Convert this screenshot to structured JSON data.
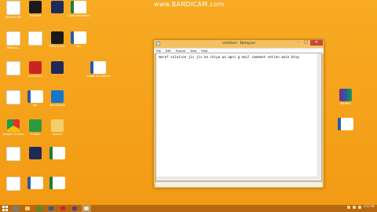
{
  "watermark": "www.BANDICAM.com",
  "desktop_icons": [
    {
      "name": "recycle-bin-icon",
      "label": "Recycle Bin",
      "glyph": "g-doc"
    },
    {
      "name": "file-icon-1",
      "label": "shortcut",
      "glyph": "g-dark"
    },
    {
      "name": "file-icon-2",
      "label": "",
      "glyph": "g-navy"
    },
    {
      "name": "excel-icon-1",
      "label": "Excel document",
      "glyph": "g-excel"
    },
    {
      "name": "app-icon-1",
      "label": "Bahasa...",
      "glyph": "g-doc"
    },
    {
      "name": "image-icon-1",
      "label": "",
      "glyph": "g-doc"
    },
    {
      "name": "app-icon-2",
      "label": "Office mod...",
      "glyph": "g-dark"
    },
    {
      "name": "word-icon-1",
      "label": "doc",
      "glyph": "g-word"
    },
    {
      "name": "file-icon-3",
      "label": "",
      "glyph": "g-doc"
    },
    {
      "name": "app-icon-3",
      "label": "bandicam",
      "glyph": "g-red"
    },
    {
      "name": "file-icon-4",
      "label": "",
      "glyph": "g-navy"
    },
    {
      "name": "word-icon-2",
      "label": "Adobe Kit Reader",
      "glyph": "g-word"
    },
    {
      "name": "file-icon-5",
      "label": "",
      "glyph": "g-doc"
    },
    {
      "name": "word-icon-3",
      "label": "doc",
      "glyph": "g-word"
    },
    {
      "name": "teamviewer-icon",
      "label": "TeamViewer",
      "glyph": "g-blue"
    },
    {
      "name": "chrome-icon",
      "label": "Google Chrome",
      "glyph": "g-chrome"
    },
    {
      "name": "app-icon-4",
      "label": "Eclipse",
      "glyph": "g-green"
    },
    {
      "name": "folder-icon-1",
      "label": "apache",
      "glyph": "g-folder"
    },
    {
      "name": "file-icon-6",
      "label": "",
      "glyph": "g-doc"
    },
    {
      "name": "app-icon-5",
      "label": "",
      "glyph": "g-navy"
    },
    {
      "name": "excel-icon-2",
      "label": "",
      "glyph": "g-excel"
    },
    {
      "name": "file-icon-7",
      "label": "",
      "glyph": "g-doc"
    },
    {
      "name": "word-icon-4",
      "label": "",
      "glyph": "g-word"
    },
    {
      "name": "excel-icon-3",
      "label": "",
      "glyph": "g-excel"
    },
    {
      "name": "file-icon-8",
      "label": "",
      "glyph": "g-doc"
    },
    {
      "name": "app-icon-6",
      "label": "",
      "glyph": "g-red"
    },
    {
      "name": "excel-icon-4",
      "label": "",
      "glyph": "g-excel"
    },
    {
      "name": "winrar-icon",
      "label": "WinRAR",
      "glyph": "g-rar"
    },
    {
      "name": "word-icon-5",
      "label": "",
      "glyph": "g-word"
    }
  ],
  "notepad": {
    "title": "Untitled - Notepad",
    "buttons": {
      "minimize": "–",
      "maximize": "□",
      "close": "✕"
    },
    "menu": [
      "File",
      "Edit",
      "Format",
      "View",
      "Help"
    ],
    "text": "meref solution jis jis ko chiya wo apni g mail comment setion main btay"
  },
  "taskbar": {
    "clock": "1:52 PM"
  }
}
